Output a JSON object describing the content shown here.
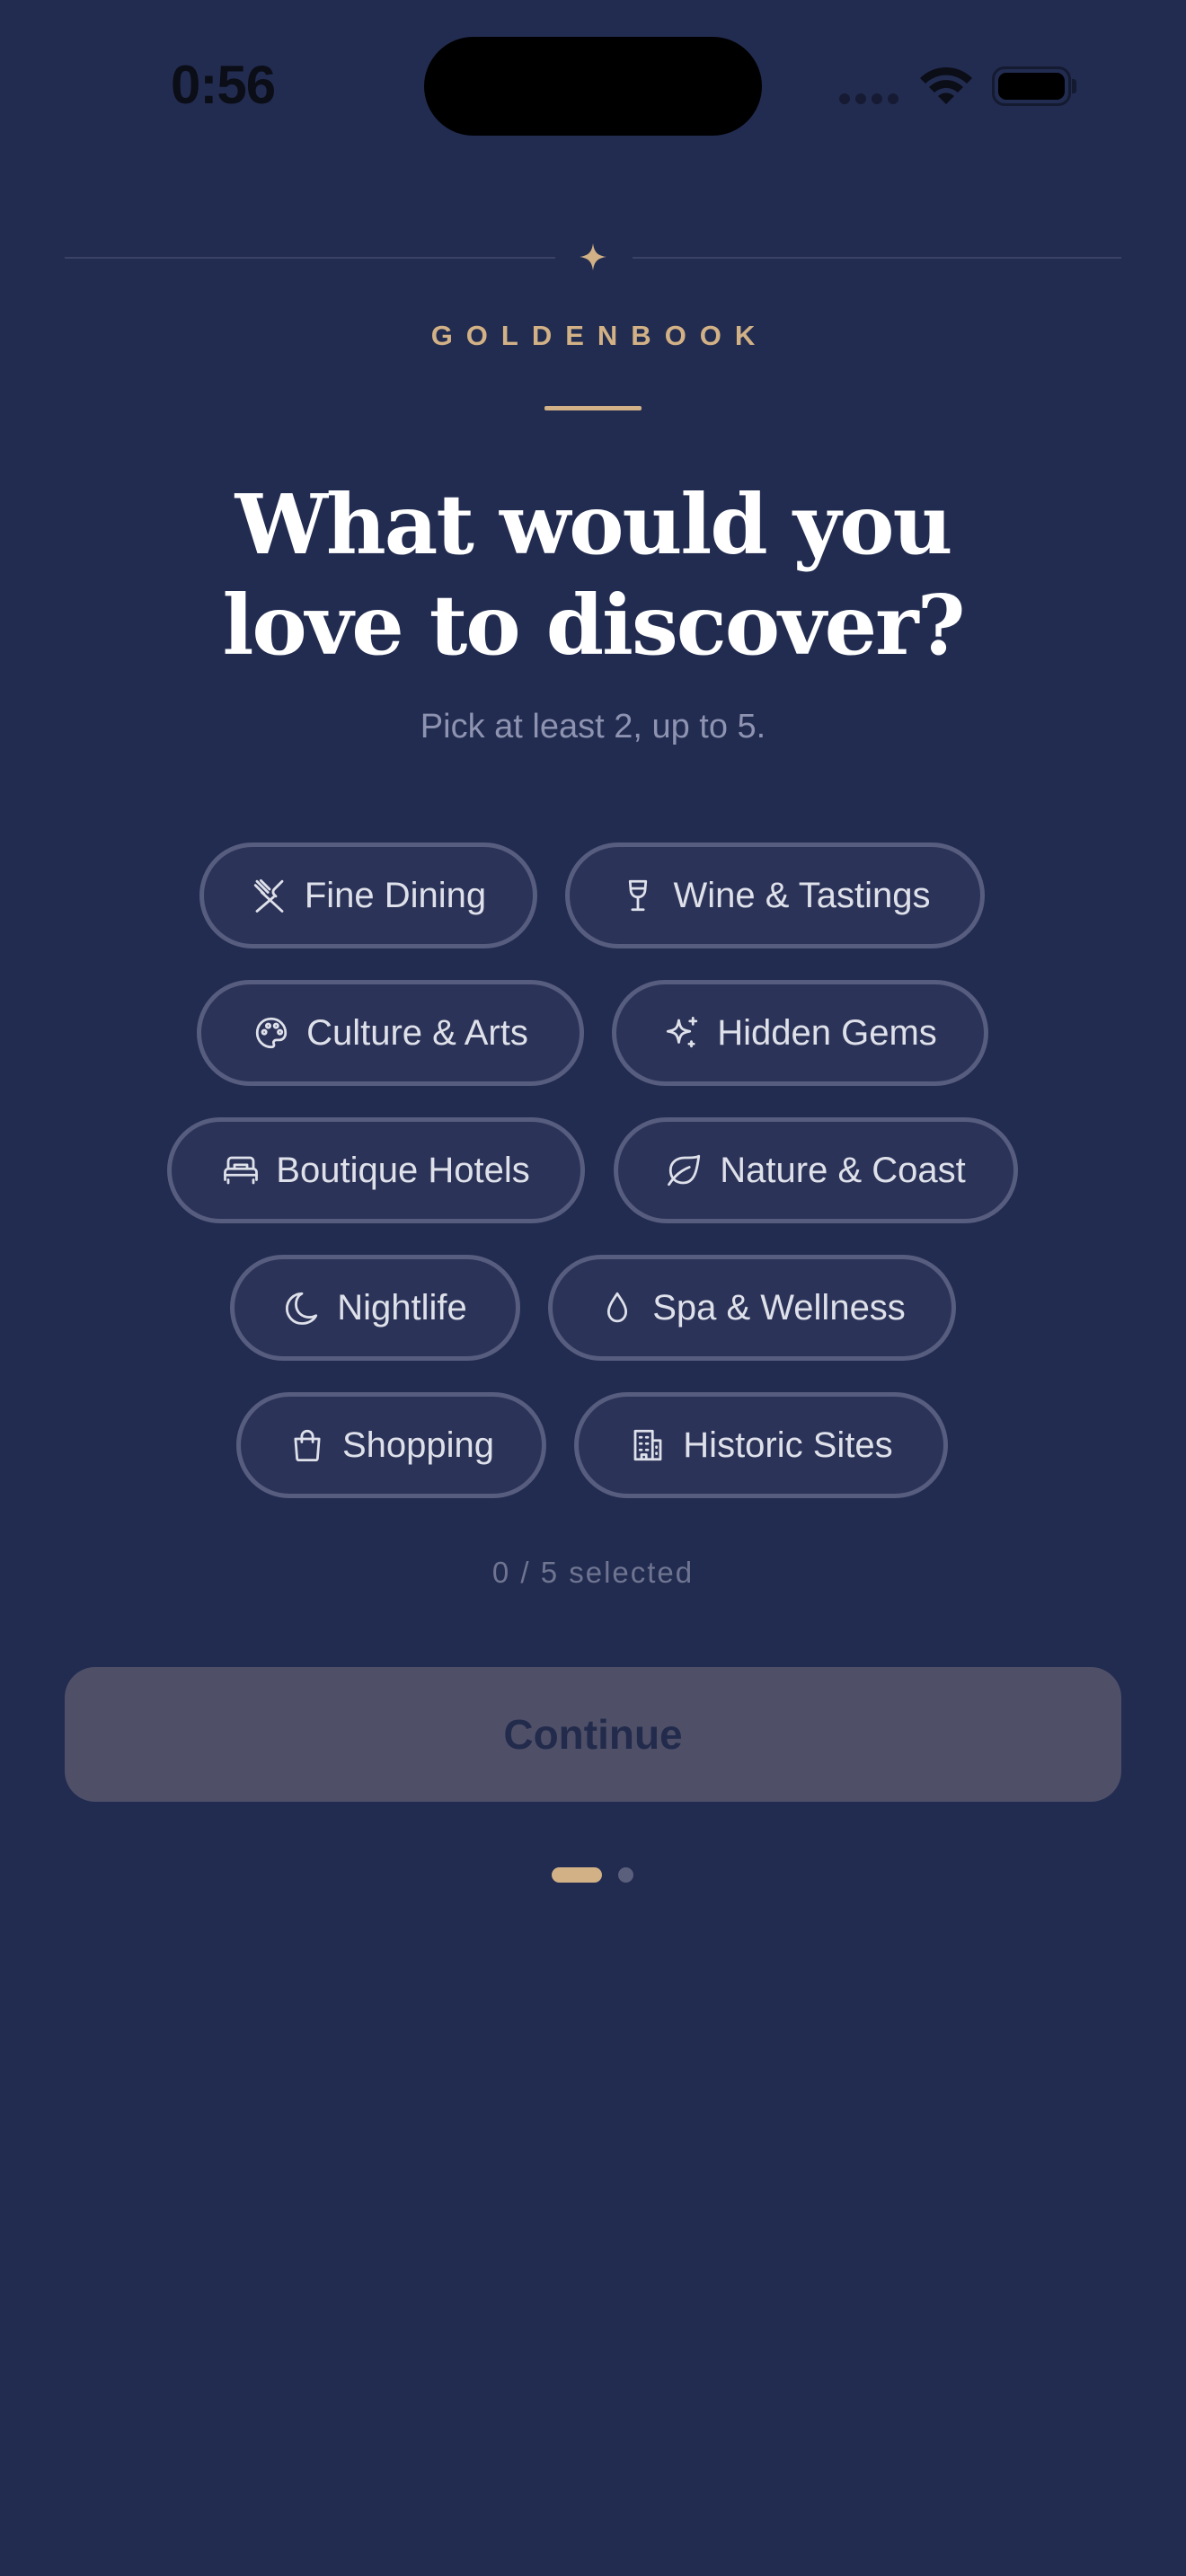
{
  "status_bar": {
    "time": "0:56"
  },
  "header": {
    "brand": "GOLDENBOOK",
    "title_line1": "What would you",
    "title_line2": "love to discover?",
    "subtitle": "Pick at least 2, up to 5."
  },
  "interests": [
    {
      "label": "Fine Dining",
      "icon": "utensils-icon"
    },
    {
      "label": "Wine & Tastings",
      "icon": "wine-glass-icon"
    },
    {
      "label": "Culture & Arts",
      "icon": "palette-icon"
    },
    {
      "label": "Hidden Gems",
      "icon": "sparkles-icon"
    },
    {
      "label": "Boutique Hotels",
      "icon": "bed-icon"
    },
    {
      "label": "Nature & Coast",
      "icon": "leaf-icon"
    },
    {
      "label": "Nightlife",
      "icon": "moon-icon"
    },
    {
      "label": "Spa & Wellness",
      "icon": "droplet-icon"
    },
    {
      "label": "Shopping",
      "icon": "shopping-bag-icon"
    },
    {
      "label": "Historic Sites",
      "icon": "building-icon"
    }
  ],
  "selection": {
    "count_text": "0 / 5 selected"
  },
  "actions": {
    "continue_label": "Continue"
  },
  "pager": {
    "total": 2,
    "current": 1
  },
  "colors": {
    "background": "#222c50",
    "accent_gold": "#d2b186",
    "chip_border": "#575d7e",
    "chip_fill": "#2b3358",
    "button_disabled": "#4f5068"
  }
}
